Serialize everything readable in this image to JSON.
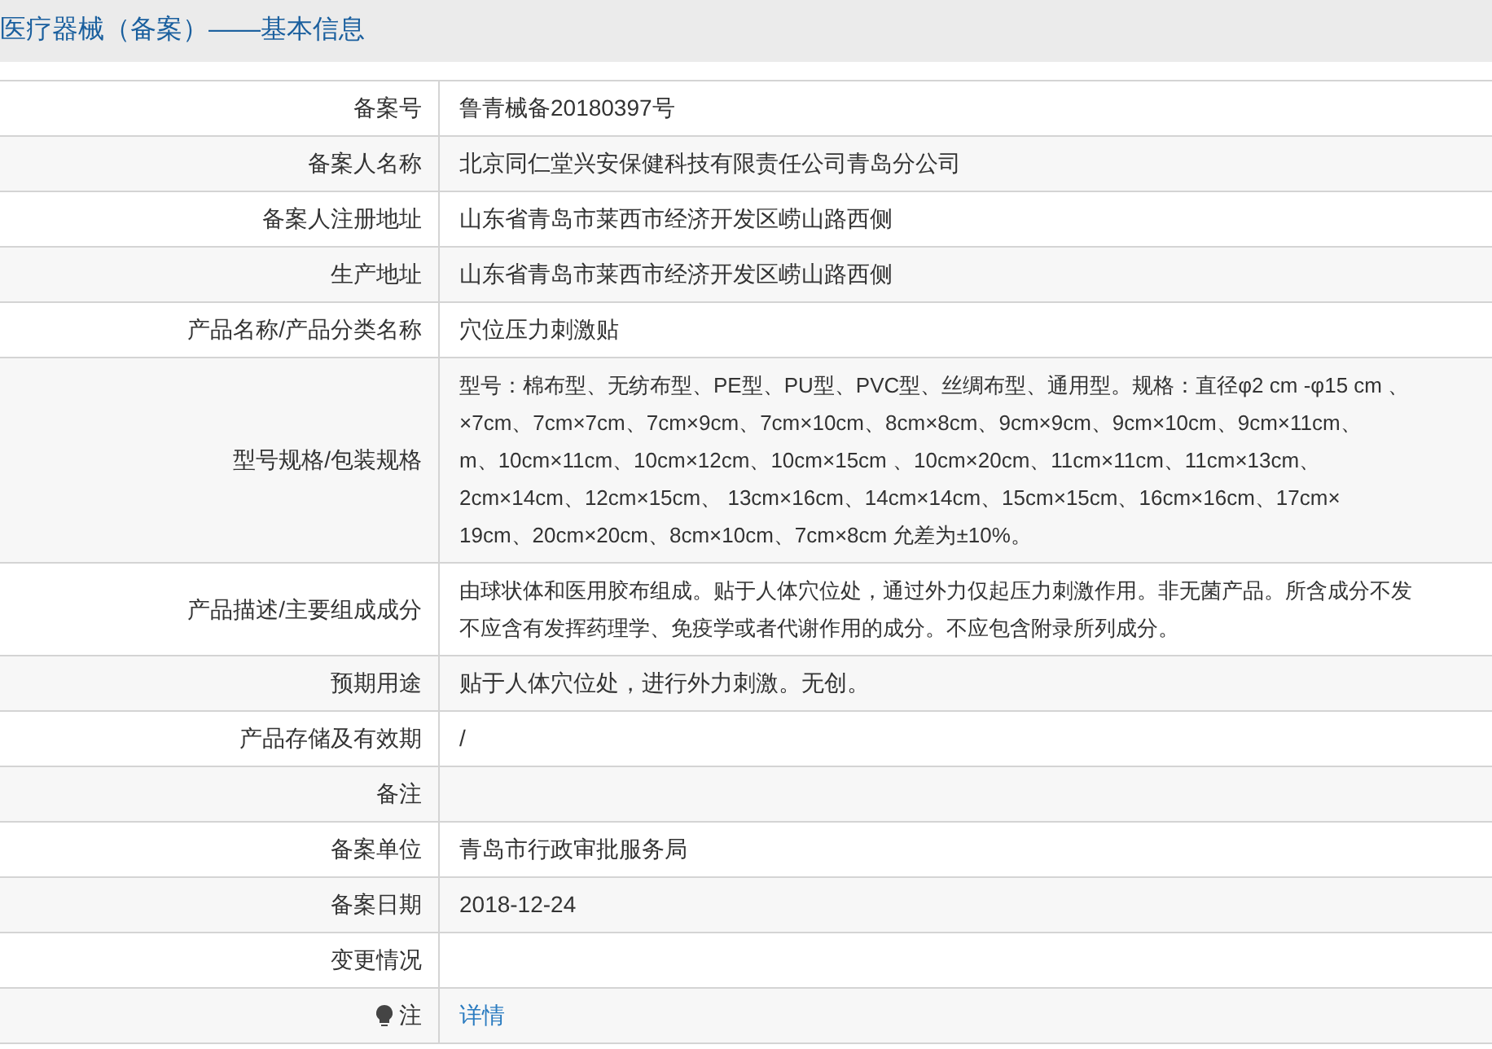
{
  "title": "医疗器械（备案）——基本信息",
  "rows": [
    {
      "label": "备案号",
      "kind": "text",
      "value": "鲁青械备20180397号"
    },
    {
      "label": "备案人名称",
      "kind": "text",
      "value": "北京同仁堂兴安保健科技有限责任公司青岛分公司"
    },
    {
      "label": "备案人注册地址",
      "kind": "text",
      "value": "山东省青岛市莱西市经济开发区崂山路西侧"
    },
    {
      "label": "生产地址",
      "kind": "text",
      "value": "山东省青岛市莱西市经济开发区崂山路西侧"
    },
    {
      "label": "产品名称/产品分类名称",
      "kind": "text",
      "value": "穴位压力刺激贴"
    },
    {
      "label": "型号规格/包装规格",
      "kind": "lines",
      "lines": [
        "型号：棉布型、无纺布型、PE型、PU型、PVC型、丝绸布型、通用型。规格：直径φ2 cm -φ15 cm 、",
        "×7cm、7cm×7cm、7cm×9cm、7cm×10cm、8cm×8cm、9cm×9cm、9cm×10cm、9cm×11cm、",
        "m、10cm×11cm、10cm×12cm、10cm×15cm 、10cm×20cm、11cm×11cm、11cm×13cm、",
        "2cm×14cm、12cm×15cm、 13cm×16cm、14cm×14cm、15cm×15cm、16cm×16cm、17cm×",
        "19cm、20cm×20cm、8cm×10cm、7cm×8cm 允差为±10%。"
      ]
    },
    {
      "label": "产品描述/主要组成成分",
      "kind": "lines",
      "lines": [
        "由球状体和医用胶布组成。贴于人体穴位处，通过外力仅起压力刺激作用。非无菌产品。所含成分不发",
        "不应含有发挥药理学、免疫学或者代谢作用的成分。不应包含附录所列成分。"
      ]
    },
    {
      "label": "预期用途",
      "kind": "text",
      "value": "贴于人体穴位处，进行外力刺激。无创。"
    },
    {
      "label": "产品存储及有效期",
      "kind": "text",
      "value": "/"
    },
    {
      "label": "备注",
      "kind": "empty"
    },
    {
      "label": "备案单位",
      "kind": "text",
      "value": "青岛市行政审批服务局"
    },
    {
      "label": "备案日期",
      "kind": "text",
      "value": "2018-12-24"
    },
    {
      "label": "变更情况",
      "kind": "empty"
    },
    {
      "label": "注",
      "kind": "note_link",
      "value": "详情"
    }
  ]
}
